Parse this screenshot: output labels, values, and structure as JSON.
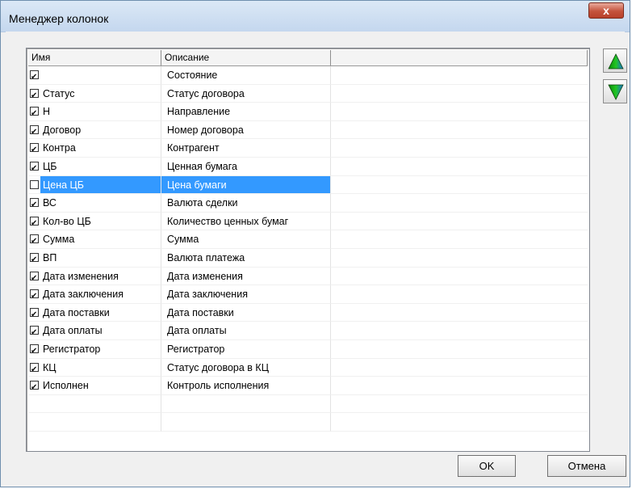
{
  "window": {
    "title": "Менеджер колонок",
    "close_glyph": "x"
  },
  "grid": {
    "columns": [
      "Имя",
      "Описание",
      ""
    ],
    "rows": [
      {
        "checked": true,
        "name": "",
        "description": "Состояние"
      },
      {
        "checked": true,
        "name": "Статус",
        "description": "Статус договора"
      },
      {
        "checked": true,
        "name": "Н",
        "description": "Направление"
      },
      {
        "checked": true,
        "name": "Договор",
        "description": "Номер договора"
      },
      {
        "checked": true,
        "name": "Контра",
        "description": "Контрагент"
      },
      {
        "checked": true,
        "name": "ЦБ",
        "description": "Ценная бумага"
      },
      {
        "checked": false,
        "name": "Цена ЦБ",
        "description": "Цена бумаги",
        "selected": true
      },
      {
        "checked": true,
        "name": "ВС",
        "description": "Валюта сделки"
      },
      {
        "checked": true,
        "name": "Кол-во ЦБ",
        "description": "Количество ценных бумаг"
      },
      {
        "checked": true,
        "name": "Сумма",
        "description": "Сумма"
      },
      {
        "checked": true,
        "name": "ВП",
        "description": "Валюта платежа"
      },
      {
        "checked": true,
        "name": "Дата изменения",
        "description": "Дата изменения"
      },
      {
        "checked": true,
        "name": "Дата заключения",
        "description": "Дата заключения"
      },
      {
        "checked": true,
        "name": "Дата поставки",
        "description": "Дата поставки"
      },
      {
        "checked": true,
        "name": "Дата оплаты",
        "description": "Дата оплаты"
      },
      {
        "checked": true,
        "name": "Регистратор",
        "description": "Регистратор"
      },
      {
        "checked": true,
        "name": "КЦ",
        "description": "Статус договора в КЦ"
      },
      {
        "checked": true,
        "name": "Исполнен",
        "description": "Контроль исполнения"
      }
    ],
    "selection_color": "#3399ff"
  },
  "side_buttons": {
    "up_icon": "move-up-arrow",
    "down_icon": "move-down-arrow"
  },
  "footer": {
    "ok_label": "OK",
    "cancel_label": "Отмена"
  }
}
